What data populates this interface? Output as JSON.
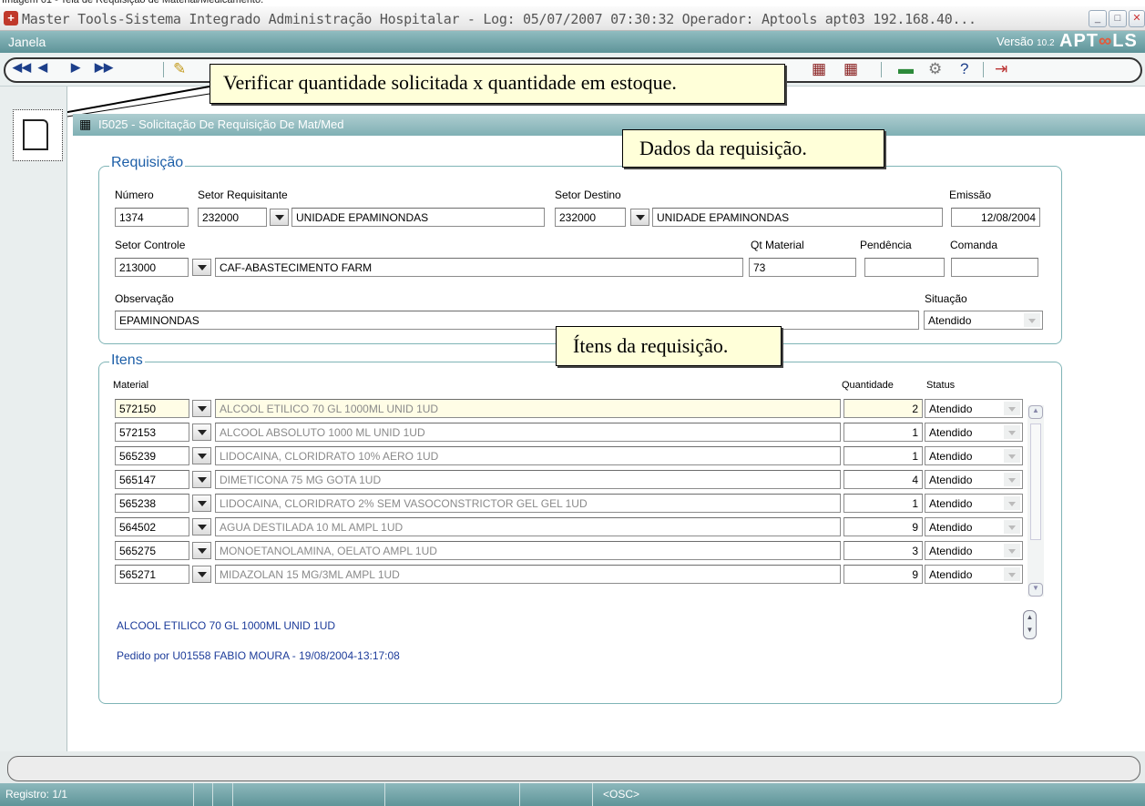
{
  "caption": "Imagem 61 - Tela de Requisição de Material/Medicamento.",
  "window": {
    "title": "Master Tools-Sistema Integrado Administração Hospitalar - Log: 05/07/2007 07:30:32 Operador: Aptools apt03 192.168.40..."
  },
  "menubar": {
    "menu_janela": "Janela",
    "version_label": "Versão",
    "version_number": "10.2",
    "logo": "APT",
    "logo_tail": "LS"
  },
  "form": {
    "title": "I5025 - Solicitação De Requisição De Mat/Med"
  },
  "callouts": {
    "toolbar": "Verificar quantidade solicitada x quantidade em estoque.",
    "dados": "Dados da requisição.",
    "itens": "Ítens da requisição."
  },
  "requisicao": {
    "legend": "Requisição",
    "numero_label": "Número",
    "numero": "1374",
    "setor_requisitante_label": "Setor Requisitante",
    "setor_requisitante_code": "232000",
    "setor_requisitante_name": "UNIDADE EPAMINONDAS",
    "setor_destino_label": "Setor Destino",
    "setor_destino_code": "232000",
    "setor_destino_name": "UNIDADE EPAMINONDAS",
    "emissao_label": "Emissão",
    "emissao": "12/08/2004",
    "setor_controle_label": "Setor Controle",
    "setor_controle_code": "213000",
    "setor_controle_name": "CAF-ABASTECIMENTO FARM",
    "qt_material_label": "Qt Material",
    "qt_material": "73",
    "pendencia_label": "Pendência",
    "pendencia": "",
    "comanda_label": "Comanda",
    "comanda": "",
    "observacao_label": "Observação",
    "observacao": "EPAMINONDAS",
    "situacao_label": "Situação",
    "situacao": "Atendido"
  },
  "itens": {
    "legend": "Itens",
    "col_material": "Material",
    "col_quantidade": "Quantidade",
    "col_status": "Status",
    "rows": [
      {
        "code": "572150",
        "desc": "ALCOOL ETILICO 70 GL 1000ML UNID 1UD",
        "qty": "2",
        "status": "Atendido"
      },
      {
        "code": "572153",
        "desc": "ALCOOL ABSOLUTO 1000 ML UNID 1UD",
        "qty": "1",
        "status": "Atendido"
      },
      {
        "code": "565239",
        "desc": "LIDOCAINA, CLORIDRATO 10% AERO 1UD",
        "qty": "1",
        "status": "Atendido"
      },
      {
        "code": "565147",
        "desc": "DIMETICONA 75 MG GOTA 1UD",
        "qty": "4",
        "status": "Atendido"
      },
      {
        "code": "565238",
        "desc": "LIDOCAINA, CLORIDRATO 2% SEM VASOCONSTRICTOR GEL GEL 1UD",
        "qty": "1",
        "status": "Atendido"
      },
      {
        "code": "564502",
        "desc": "AGUA DESTILADA 10 ML AMPL 1UD",
        "qty": "9",
        "status": "Atendido"
      },
      {
        "code": "565275",
        "desc": "MONOETANOLAMINA, OELATO AMPL 1UD",
        "qty": "3",
        "status": "Atendido"
      },
      {
        "code": "565271",
        "desc": "MIDAZOLAN 15 MG/3ML AMPL 1UD",
        "qty": "9",
        "status": "Atendido"
      }
    ],
    "selected_desc": "ALCOOL ETILICO 70 GL 1000ML UNID 1UD",
    "pedido_por": "Pedido por U01558 FABIO MOURA - 19/08/2004-13:17:08"
  },
  "statusbar": {
    "registro": "Registro: 1/1",
    "mode": "<OSC>"
  }
}
